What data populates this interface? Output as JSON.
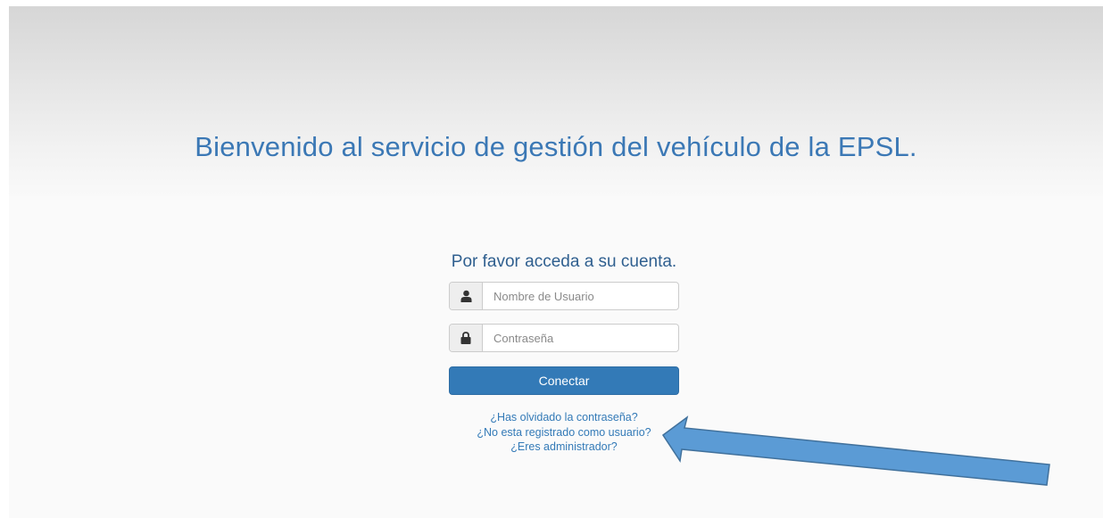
{
  "header": {
    "welcome_text": "Bienvenido al servicio de gestión del vehículo de la EPSL."
  },
  "login": {
    "subtitle": "Por favor acceda a su cuenta.",
    "username_placeholder": "Nombre de Usuario",
    "password_placeholder": "Contraseña",
    "submit_label": "Conectar",
    "username_icon": "user-icon",
    "password_icon": "lock-icon"
  },
  "links": {
    "forgot_password": "¿Has olvidado la contraseña?",
    "register": "¿No esta registrado como usuario?",
    "admin": "¿Eres administrador?"
  },
  "colors": {
    "title": "#3b78b5",
    "primary_button": "#337ab7",
    "link": "#337ab7",
    "annotation_arrow": "#5b9bd5"
  }
}
